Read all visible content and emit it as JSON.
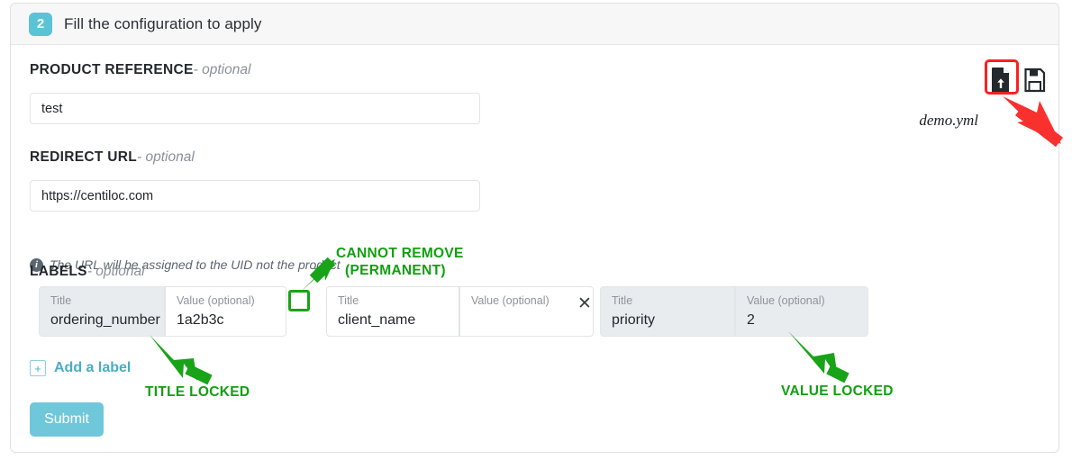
{
  "card": {
    "header": {
      "step_number": "2",
      "title": "Fill the configuration to apply"
    }
  },
  "file_bar": {
    "file_name": "demo.yml",
    "upload_icon": "file-upload-icon",
    "save_icon": "floppy-save-icon"
  },
  "fields": {
    "product_reference": {
      "label": "PRODUCT REFERENCE",
      "optional_suffix": "- optional",
      "value": "test",
      "placeholder": ""
    },
    "redirect_url": {
      "label": "REDIRECT URL",
      "optional_suffix": "- optional",
      "value": "https://centiloc.com",
      "placeholder": "",
      "hint": "The URL will be assigned to the UID not the product",
      "hint_icon": "info-circle-icon"
    },
    "labels_section": {
      "label": "LABELS",
      "optional_suffix": "- optional",
      "title_caption": "Title",
      "value_caption": "Value (optional)",
      "rows": [
        {
          "title": "ordering_number",
          "title_locked": true,
          "value": "1a2b3c",
          "value_locked": false,
          "removable": false
        },
        {
          "title": "client_name",
          "title_locked": false,
          "value": "",
          "value_locked": false,
          "removable": true,
          "remove_icon": "close-icon"
        },
        {
          "title": "priority",
          "title_locked": true,
          "value": "2",
          "value_locked": true,
          "removable": false
        }
      ],
      "add_label_text": "Add a label",
      "add_label_icon": "plus-box-icon"
    }
  },
  "actions": {
    "submit_label": "Submit"
  },
  "annotations": {
    "cannot_remove_line1": "CANNOT REMOVE",
    "cannot_remove_line2": "(PERMANENT)",
    "title_locked": "TITLE LOCKED",
    "value_locked": "VALUE LOCKED"
  },
  "colors": {
    "accent_teal": "#5bc3d6",
    "submit_teal": "#6fc8da",
    "annotation_green": "#11a011",
    "annotation_red": "#fa2020",
    "locked_field_bg": "#e9ecef",
    "header_bg": "#f7f7f7"
  }
}
